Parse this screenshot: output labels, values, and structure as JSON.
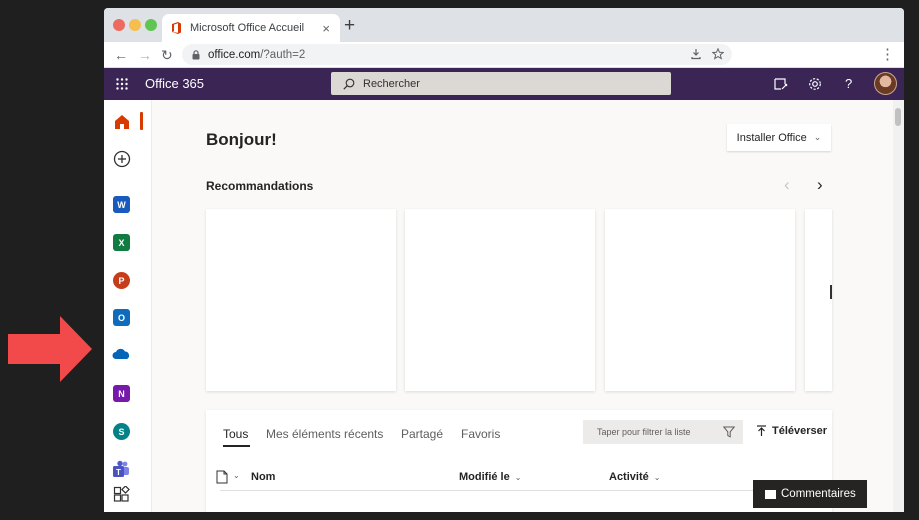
{
  "browser": {
    "tab_title": "Microsoft Office Accueil",
    "tab_close": "×",
    "new_tab": "+",
    "url_host": "office.com",
    "url_path": "/?auth=2",
    "nav": {
      "back": "←",
      "forward": "→",
      "reload": "↻"
    },
    "menu": "⋮"
  },
  "topbar": {
    "brand": "Office 365",
    "search_placeholder": "Rechercher",
    "icons": [
      "feedback-whiteboard-icon",
      "settings-icon",
      "help-icon",
      "avatar"
    ],
    "help_glyph": "?"
  },
  "rail": {
    "apps": [
      {
        "name": "home",
        "color": "#d83b01"
      },
      {
        "name": "create",
        "color": "#323130"
      },
      {
        "name": "word",
        "color": "#185abd",
        "letter": "W"
      },
      {
        "name": "excel",
        "color": "#107c41",
        "letter": "X"
      },
      {
        "name": "powerpoint",
        "color": "#c43e1c",
        "letter": "P"
      },
      {
        "name": "outlook",
        "color": "#0f6cbd",
        "letter": "O"
      },
      {
        "name": "onedrive",
        "color": "#0364b8"
      },
      {
        "name": "onenote",
        "color": "#7719aa",
        "letter": "N"
      },
      {
        "name": "sharepoint",
        "color": "#038387",
        "letter": "S"
      },
      {
        "name": "teams",
        "color": "#4b53bc"
      },
      {
        "name": "all-apps",
        "color": "#323130"
      }
    ]
  },
  "main": {
    "greeting": "Bonjour!",
    "install_label": "Installer Office",
    "chev": "⌄",
    "recommendations_title": "Recommandations",
    "reco_prev": "‹",
    "reco_next": "›",
    "files": {
      "tabs": [
        "Tous",
        "Mes éléments récents",
        "Partagé",
        "Favoris"
      ],
      "filter_placeholder": "Taper pour filtrer la liste",
      "upload_label": "Téléverser",
      "columns": [
        "Nom",
        "Modifié le",
        "Activité"
      ]
    }
  },
  "feedback_label": "Commentaires",
  "colors": {
    "accent_bar": "#3a2555",
    "arrow": "#f24a4a",
    "office_red": "#d83b01"
  }
}
